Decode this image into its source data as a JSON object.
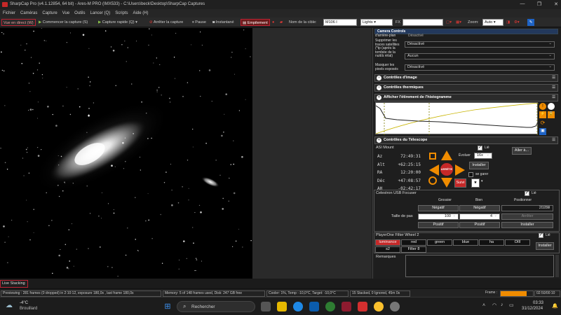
{
  "window": {
    "title": "SharpCap Pro (v4.1.12854, 64 bit) - Ares-M PRO (IMX533) - C:\\Users\\beck\\Desktop\\SharpCap Captures"
  },
  "menu": [
    "Fichier",
    "Caméras",
    "Capture",
    "Vue",
    "Outils",
    "Lancer (Q)",
    "Scripts",
    "Aide (H)"
  ],
  "toolbar": {
    "live_view": "Vue en direct (W)",
    "start_capture": "Commencer la capture (S)",
    "quick_capture": "Capture rapide (Q)",
    "stop_capture": "Arrêter la capture",
    "pause": "Pause",
    "snapshot": "Instantané",
    "stacking": "Empilement",
    "target_label": "Nom de la cible:",
    "target_value": "M106 I",
    "frame_type": "Lights",
    "fx_label": "FX",
    "zoom_label": "Zoom:",
    "zoom_value": "Auto"
  },
  "camera_controls": {
    "header": "Camera Controls",
    "partial_label": "d'arrière-plan",
    "partial_value": "Désactivé",
    "rows": [
      {
        "label": "Supprimer les\ntraces satellites\n(*tp (après la\ntombée de la\nnuit/à rétal)",
        "value": "Désactivé"
      },
      {
        "label": "",
        "value": "Aucun"
      },
      {
        "label": "Masquer les\npixels exposés",
        "value": "Désactivé"
      }
    ]
  },
  "sections": {
    "image": "Contrôles d'image",
    "thermal": "Contrôles thermiques",
    "histogram": "Afficher l'étirement de l'histogramme",
    "telescope": "Contrôles du Télescope"
  },
  "mount": {
    "name": "ASI Mount",
    "linked_label": "Lié",
    "goto_button": "Aller à...",
    "az_label": "Az",
    "az_value": "72:49:31",
    "alt_label": "Alt",
    "alt_value": "+62:25:15",
    "ra_label": "RA",
    "ra_value": "12:20:00",
    "dec_label": "Déc",
    "dec_value": "+47:08:57",
    "ah_label": "AH",
    "ah_value": "-02:42:17",
    "rate_label": "Évoluer",
    "rate_value": "16x",
    "install_button": "Installer",
    "stop_button": "ARRÊTE",
    "park_label": "se garer",
    "follow_button": "Suivi"
  },
  "focuser": {
    "name": "Celestron USB Focuser",
    "linked_label": "Lié",
    "coarse_label": "Grossier",
    "fine_label": "Bien",
    "position_label": "Positionner",
    "negative_label": "Négatif",
    "positive_label": "Positif",
    "position_value": "20288",
    "step_label": "Taille de pas",
    "coarse_step": "100",
    "fine_step": "4",
    "stop_button": "Arrêter",
    "install_button": "Installer"
  },
  "filterwheel": {
    "name": "PlayerOne Filter Wheel 2",
    "linked_label": "Lié",
    "filters": [
      "luminance",
      "red",
      "green",
      "blue",
      "ha",
      "OIII",
      "s2",
      "Filter 8"
    ],
    "active": "luminance",
    "install_button": "Installer"
  },
  "notes": {
    "label": "Remarques"
  },
  "status": {
    "live_stacking": "Live Stacking",
    "previewing": "Previewing : 281 frames (0 dropped) in 2:10:12, exposure 180,0s , last frame 180,0s",
    "memory": "Memory: 5 of 148 frames used, Disk: 247 GB free",
    "cooler": "Cooler: 1%, Temp: -10,0°C, Target: -10,0°C",
    "stacked": "15 Stacked, 0 Ignored, 45m 0s",
    "frame_label": "Frame :",
    "frame_progress": 0.8,
    "frame_time": "02:50/00:10"
  },
  "taskbar": {
    "weather_temp": "-4°C",
    "weather_desc": "Brouillard",
    "search_placeholder": "Rechercher",
    "time": "03:33",
    "date": "31/12/2024"
  },
  "colors": {
    "accent": "#f08c00",
    "danger": "#c62828",
    "link": "#ffffff"
  }
}
